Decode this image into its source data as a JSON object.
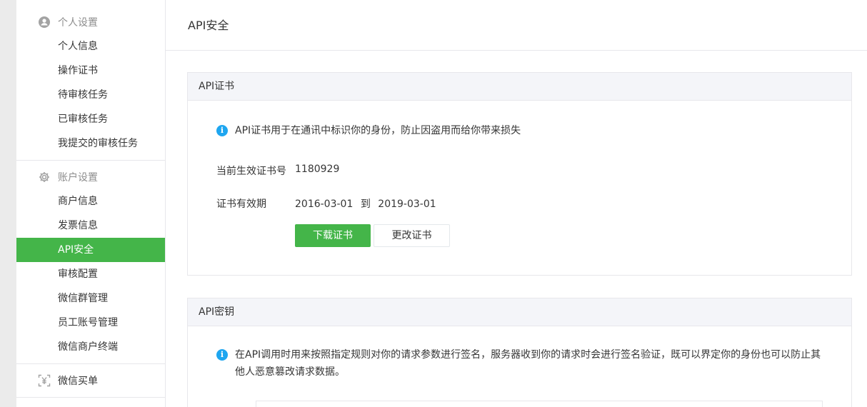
{
  "sidebar": {
    "personal_group": {
      "icon": "user-icon",
      "title": "个人设置"
    },
    "personal_items": [
      "个人信息",
      "操作证书",
      "待审核任务",
      "已审核任务",
      "我提交的审核任务"
    ],
    "account_group": {
      "icon": "gear-icon",
      "title": "账户设置"
    },
    "account_items": [
      "商户信息",
      "发票信息",
      "API安全",
      "审核配置",
      "微信群管理",
      "员工账号管理",
      "微信商户终端"
    ],
    "active_item": "API安全",
    "pay_group": {
      "icon": "yuan-scan-icon",
      "title": "微信买单"
    }
  },
  "main": {
    "title": "API安全",
    "cert_panel": {
      "title": "API证书",
      "info": "API证书用于在通讯中标识你的身份，防止因盗用而给你带来损失",
      "serial_label": "当前生效证书号",
      "serial_value": "1180929",
      "validity_label": "证书有效期",
      "validity_from": "2016-03-01",
      "validity_to_word": "到",
      "validity_to": "2019-03-01",
      "download_button": "下载证书",
      "change_button": "更改证书"
    },
    "key_panel": {
      "title": "API密钥",
      "info_line1": "在API调用时用来按照指定规则对你的请求参数进行签名，服务器收到你的请求时会进行签名验证，既可以界定你的身份也可以防止其",
      "info_line2": "他人恶意篡改请求数据。"
    }
  },
  "colors": {
    "accent": "#44b549",
    "info": "#1ea6f0",
    "border": "#e7e7eb",
    "panel_head": "#f4f5f9"
  }
}
